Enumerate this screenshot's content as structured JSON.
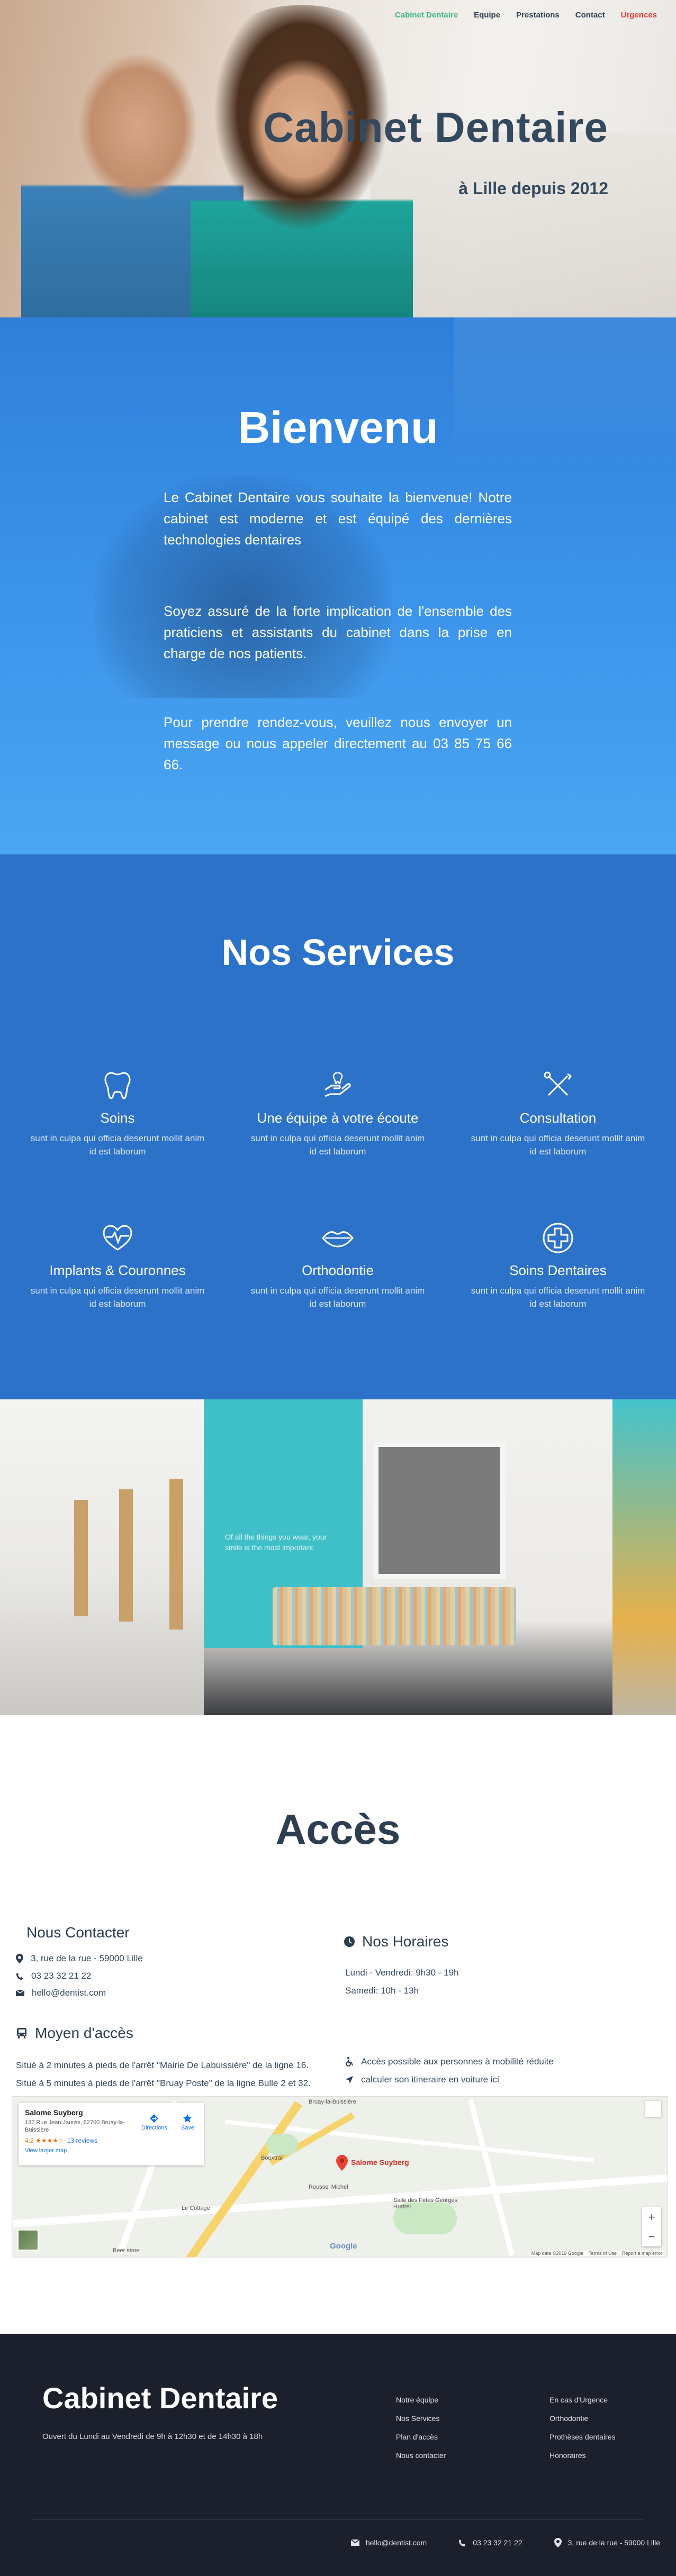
{
  "nav": {
    "items": [
      "Cabinet Dentaire",
      "Equipe",
      "Prestations",
      "Contact",
      "Urgences"
    ]
  },
  "hero": {
    "title": "Cabinet Dentaire",
    "subtitle": "à Lille depuis 2012"
  },
  "welcome": {
    "title": "Bienvenu",
    "p1": "Le Cabinet Dentaire vous souhaite la bienvenue! Notre cabinet est moderne et est équipé des dernières technologies dentaires",
    "p2": "Soyez assuré de la forte implication de l'ensemble des praticiens et assistants du cabinet dans la prise en charge de nos patients.",
    "p3": "Pour prendre rendez-vous, veuillez nous envoyer un message ou nous appeler directement au 03 85 75 66 66."
  },
  "services": {
    "title": "Nos Services",
    "items": [
      {
        "name": "Soins",
        "desc": "sunt in culpa qui officia deserunt mollit anim id est laborum",
        "icon": "tooth-icon"
      },
      {
        "name": "Une équipe à votre écoute",
        "desc": "sunt in culpa qui officia deserunt mollit anim id est laborum",
        "icon": "hand-tooth-icon"
      },
      {
        "name": "Consultation",
        "desc": "sunt in culpa qui officia deserunt mollit anim id est laborum",
        "icon": "dental-tools-icon"
      },
      {
        "name": "Implants & Couronnes",
        "desc": "sunt in culpa qui officia deserunt mollit anim id est laborum",
        "icon": "heartbeat-icon"
      },
      {
        "name": "Orthodontie",
        "desc": "sunt in culpa qui officia deserunt mollit anim id est laborum",
        "icon": "lips-icon"
      },
      {
        "name": "Soins Dentaires",
        "desc": "sunt in culpa qui officia deserunt mollit anim id est laborum",
        "icon": "medical-cross-icon"
      }
    ]
  },
  "photos": {
    "wall_text": "Of all the things you wear, your smile is the most important."
  },
  "acces": {
    "title": "Accès",
    "contact_title": "Nous Contacter",
    "address": "3, rue de la rue - 59000 Lille",
    "phone": "03 23 32 21 22",
    "email": "hello@dentist.com",
    "hours_title": "Nos Horaires",
    "hours_week": "Lundi - Vendredi: 9h30 - 19h",
    "hours_sat": "Samedi: 10h - 13h",
    "access_title": "Moyen d'accès",
    "access_1": "Situé à 2 minutes à pieds de l'arrêt \"Mairie De Labuissière\" de la ligne 16.",
    "access_2": "Situé à 5 minutes à pieds de l'arrêt \"Bruay Poste\" de la ligne Bulle 2 et 32.",
    "reduced_mobility": "Accès possible aux personnes à mobilité réduite",
    "route": "calculer son itineraire en voiture ici"
  },
  "map": {
    "place_name": "Salome Suyberg",
    "place_address": "137 Rue Jean Jaurès, 62700 Bruay-la-Buissière",
    "rating": "4.2 ★★★★☆",
    "reviews": "13 reviews",
    "larger_map": "View larger map",
    "directions": "Directions",
    "save": "Save",
    "pin_label": "Salome Suyberg",
    "labels": [
      "Bruay-la-Buissière",
      "Bouxtrail",
      "Roussel Michel",
      "Salle des Fêtes Georges Hurtrel",
      "Le Cottage",
      "Beer store"
    ],
    "footer": [
      "Map data ©2019 Google",
      "Terms of Use",
      "Report a map error"
    ],
    "google": "Google"
  },
  "footer": {
    "brand": "Cabinet Dentaire",
    "hours": "Ouvert du Lundi au Vendredi de 9h à 12h30 et de 14h30 à 18h",
    "col1": [
      "Notre équipe",
      "Nos Services",
      "Plan d'accès",
      "Nous contacter"
    ],
    "col2": [
      "En cas d'Urgence",
      "Orthodontie",
      "Prothèses dentaires",
      "Honoraires"
    ],
    "email": "hello@dentist.com",
    "phone": "03 23 32 21 22",
    "address": "3, rue de la rue - 59000 Lille"
  },
  "colors": {
    "accent_green": "#3bb77e",
    "urgent_red": "#e53935",
    "welcome_blue": "#3b93ea",
    "services_blue": "#2d72c9",
    "footer_dark": "#1c202c"
  }
}
